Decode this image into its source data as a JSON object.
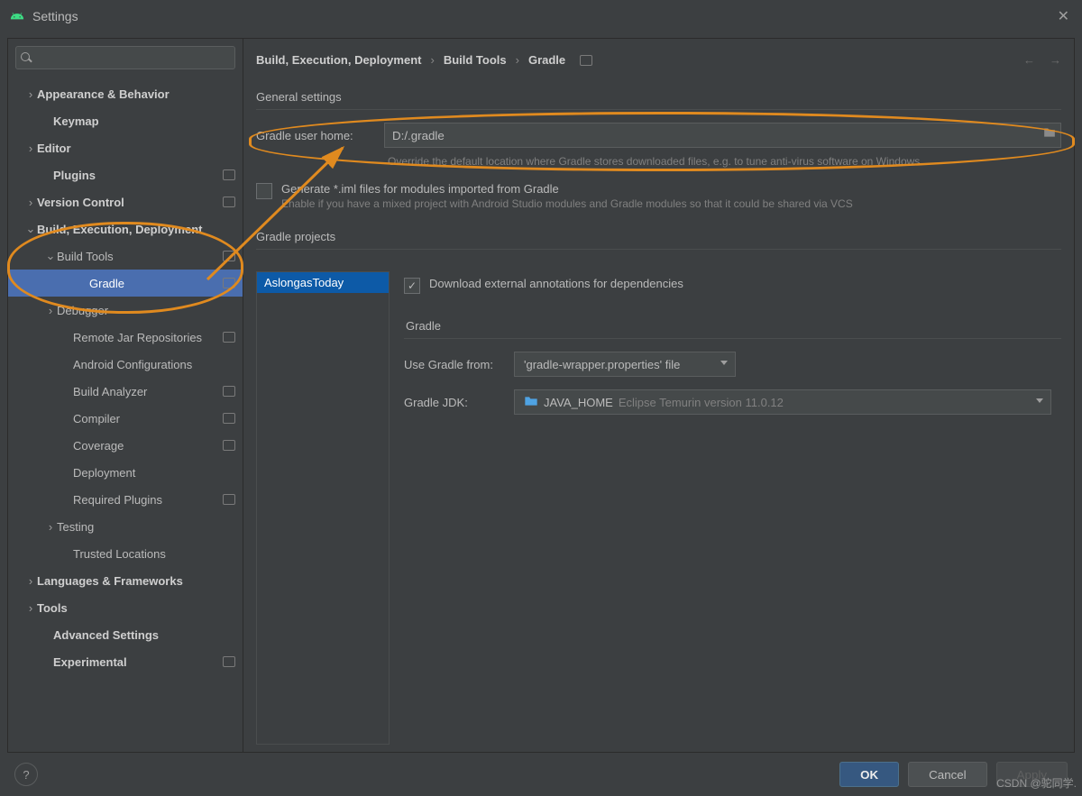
{
  "window": {
    "title": "Settings"
  },
  "sidebar": {
    "search_placeholder": "",
    "items": [
      {
        "label": "Appearance & Behavior",
        "indent": 18,
        "chev": "›",
        "bold": true
      },
      {
        "label": "Keymap",
        "indent": 36,
        "chev": "",
        "bold": true
      },
      {
        "label": "Editor",
        "indent": 18,
        "chev": "›",
        "bold": true
      },
      {
        "label": "Plugins",
        "indent": 36,
        "chev": "",
        "bold": true,
        "badge": true
      },
      {
        "label": "Version Control",
        "indent": 18,
        "chev": "›",
        "bold": true,
        "badge": true
      },
      {
        "label": "Build, Execution, Deployment",
        "indent": 18,
        "chev": "⌄",
        "bold": true
      },
      {
        "label": "Build Tools",
        "indent": 40,
        "chev": "⌄",
        "bold": false,
        "badge": true
      },
      {
        "label": "Gradle",
        "indent": 76,
        "chev": "",
        "bold": false,
        "badge": true,
        "selected": true
      },
      {
        "label": "Debugger",
        "indent": 40,
        "chev": "›",
        "bold": false
      },
      {
        "label": "Remote Jar Repositories",
        "indent": 58,
        "chev": "",
        "bold": false,
        "badge": true
      },
      {
        "label": "Android Configurations",
        "indent": 58,
        "chev": "",
        "bold": false
      },
      {
        "label": "Build Analyzer",
        "indent": 58,
        "chev": "",
        "bold": false,
        "badge": true
      },
      {
        "label": "Compiler",
        "indent": 58,
        "chev": "",
        "bold": false,
        "badge": true
      },
      {
        "label": "Coverage",
        "indent": 58,
        "chev": "",
        "bold": false,
        "badge": true
      },
      {
        "label": "Deployment",
        "indent": 58,
        "chev": "",
        "bold": false
      },
      {
        "label": "Required Plugins",
        "indent": 58,
        "chev": "",
        "bold": false,
        "badge": true
      },
      {
        "label": "Testing",
        "indent": 40,
        "chev": "›",
        "bold": false
      },
      {
        "label": "Trusted Locations",
        "indent": 58,
        "chev": "",
        "bold": false
      },
      {
        "label": "Languages & Frameworks",
        "indent": 18,
        "chev": "›",
        "bold": true
      },
      {
        "label": "Tools",
        "indent": 18,
        "chev": "›",
        "bold": true
      },
      {
        "label": "Advanced Settings",
        "indent": 36,
        "chev": "",
        "bold": true
      },
      {
        "label": "Experimental",
        "indent": 36,
        "chev": "",
        "bold": true,
        "badge": true
      }
    ]
  },
  "breadcrumb": {
    "a": "Build, Execution, Deployment",
    "b": "Build Tools",
    "c": "Gradle"
  },
  "general": {
    "title": "General settings",
    "home_label": "Gradle user home:",
    "home_value": "D:/.gradle",
    "home_hint": "Override the default location where Gradle stores downloaded files, e.g. to tune anti-virus software on Windows",
    "iml_label": "Generate *.iml files for modules imported from Gradle",
    "iml_hint": "Enable if you have a mixed project with Android Studio modules and Gradle modules so that it could be shared via VCS"
  },
  "projects": {
    "title": "Gradle projects",
    "list": [
      "AslongasToday"
    ],
    "download_label": "Download external annotations for dependencies",
    "section": "Gradle",
    "use_from_label": "Use Gradle from:",
    "use_from_value": "'gradle-wrapper.properties' file",
    "jdk_label": "Gradle JDK:",
    "jdk_name": "JAVA_HOME",
    "jdk_detail": "Eclipse Temurin version 11.0.12"
  },
  "footer": {
    "ok": "OK",
    "cancel": "Cancel",
    "apply": "Apply"
  },
  "watermark": "CSDN @驼同学."
}
